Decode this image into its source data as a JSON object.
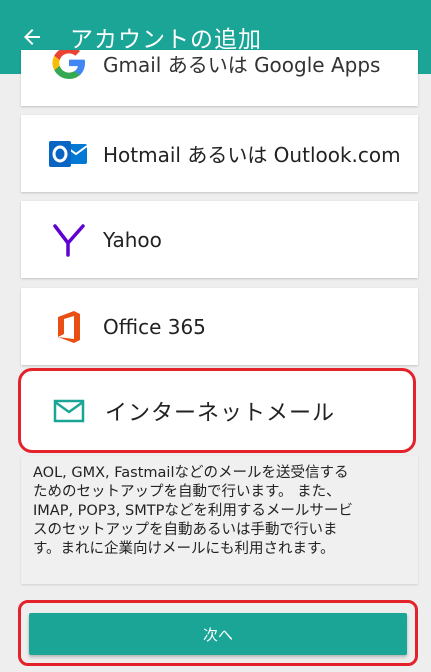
{
  "appbar": {
    "title": "アカウントの追加",
    "back_icon": "arrow-left-icon",
    "color": "#1aa597"
  },
  "providers": {
    "gmail": {
      "label": "Gmail あるいは Google Apps",
      "icon": "google-icon"
    },
    "hotmail": {
      "label": "Hotmail あるいは Outlook.com",
      "icon": "outlook-icon"
    },
    "yahoo": {
      "label": "Yahoo",
      "icon": "yahoo-icon"
    },
    "office": {
      "label": "Office 365",
      "icon": "office-icon"
    },
    "internet": {
      "label": "インターネットメール",
      "icon": "mail-icon",
      "highlight_color": "#e3222b"
    }
  },
  "description": {
    "lines": [
      "AOL, GMX, Fastmailなどのメールを送受信する",
      "ためのセットアップを自動で行います。 また、",
      "IMAP, POP3, SMTPなどを利用するメールサービ",
      "スのセットアップを自動あるいは手動で行いま",
      "す。まれに企業向けメールにも利用されます。"
    ]
  },
  "next_button": {
    "label": "次へ"
  }
}
